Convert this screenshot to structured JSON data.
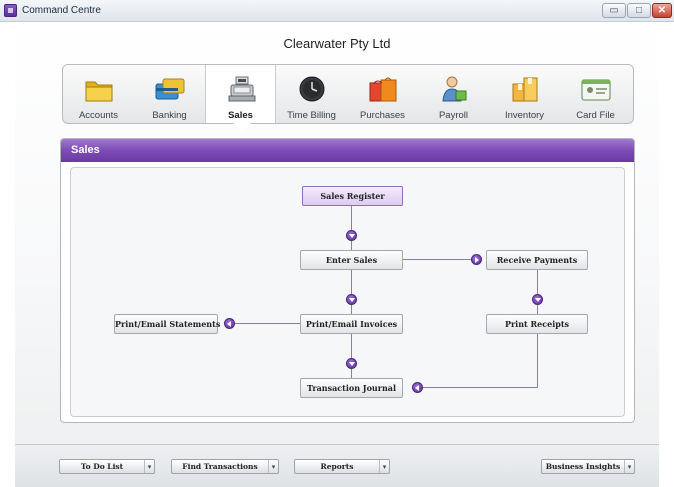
{
  "window": {
    "title": "Command Centre",
    "min_glyph": "▭",
    "max_glyph": "□",
    "close_glyph": "✕"
  },
  "company_name": "Clearwater Pty Ltd",
  "tabs": [
    {
      "label": "Accounts",
      "icon": "folder-icon"
    },
    {
      "label": "Banking",
      "icon": "cards-icon"
    },
    {
      "label": "Sales",
      "icon": "cash-register-icon",
      "active": true
    },
    {
      "label": "Time Billing",
      "icon": "clock-icon"
    },
    {
      "label": "Purchases",
      "icon": "shopping-bags-icon"
    },
    {
      "label": "Payroll",
      "icon": "person-icon"
    },
    {
      "label": "Inventory",
      "icon": "boxes-icon"
    },
    {
      "label": "Card File",
      "icon": "contact-card-icon"
    }
  ],
  "panel": {
    "title": "Sales",
    "buttons": {
      "sales_register": "Sales Register",
      "enter_sales": "Enter Sales",
      "receive_payments": "Receive Payments",
      "print_email_invoices": "Print/Email Invoices",
      "print_email_statements": "Print/Email Statements",
      "print_receipts": "Print Receipts",
      "transaction_journal": "Transaction Journal"
    }
  },
  "bottom": {
    "todo": "To Do List",
    "find": "Find Transactions",
    "reports": "Reports",
    "insights": "Business Insights",
    "caret": "▾"
  },
  "colors": {
    "accent": "#7d4bb5",
    "arrow": "#5e2f98"
  }
}
